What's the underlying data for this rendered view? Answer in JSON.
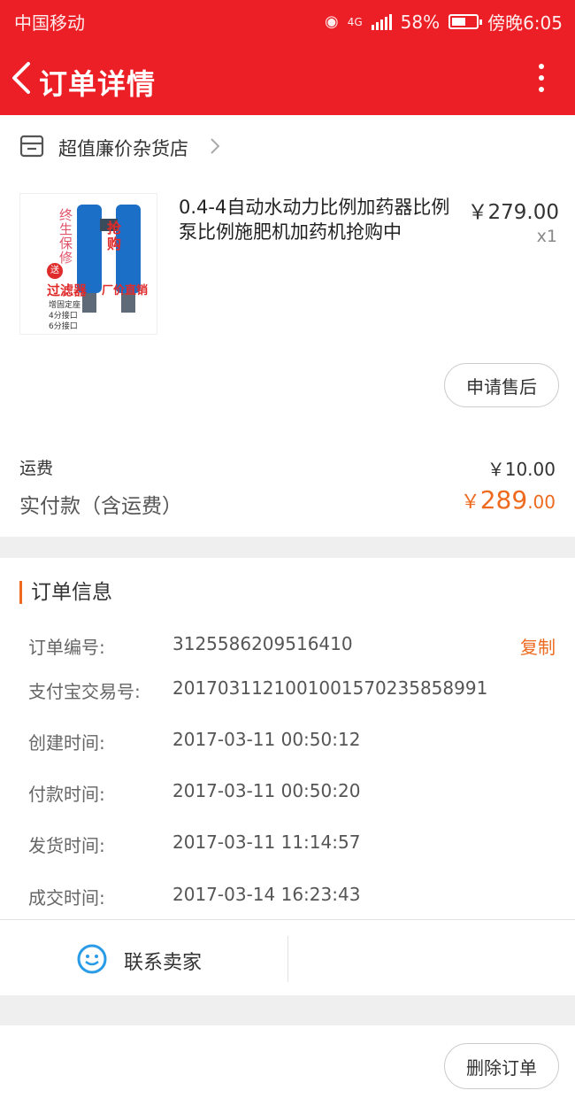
{
  "status_bar": {
    "carrier": "中国移动",
    "network": "4G",
    "battery": "58%",
    "time": "傍晚6:05"
  },
  "nav": {
    "title": "订单详情"
  },
  "store": {
    "name": "超值廉价杂货店"
  },
  "product": {
    "title": "0.4-4自动水动力比例加药器比例泵比例施肥机加药机抢购中",
    "price": "￥279.00",
    "quantity": "x1",
    "image_text": {
      "warranty": "终生保修",
      "gift": "送",
      "filter": "过滤器",
      "rush": "抢购",
      "direct": "厂价直销",
      "spec1": "增固定座",
      "spec2": "4分接口",
      "spec3": "6分接口"
    }
  },
  "actions": {
    "after_sale": "申请售后",
    "contact_seller": "联系卖家",
    "delete_order": "删除订单"
  },
  "summary": {
    "shipping_label": "运费",
    "shipping_value": "￥10.00",
    "paid_label": "实付款（含运费）",
    "paid_symbol": "￥",
    "paid_int": "289",
    "paid_dec": ".00"
  },
  "order_info": {
    "title": "订单信息",
    "copy_label": "复制",
    "rows": [
      {
        "label": "订单编号:",
        "value": "3125586209516410"
      },
      {
        "label": "支付宝交易号:",
        "value": "2017031121001001570235858991"
      },
      {
        "label": "创建时间:",
        "value": "2017-03-11 00:50:12"
      },
      {
        "label": "付款时间:",
        "value": "2017-03-11 00:50:20"
      },
      {
        "label": "发货时间:",
        "value": "2017-03-11 11:14:57"
      },
      {
        "label": "成交时间:",
        "value": "2017-03-14 16:23:43"
      }
    ]
  },
  "colors": {
    "header_red": "#ec1f26",
    "accent_orange": "#ee6a1e",
    "contact_blue": "#2a9be6"
  }
}
